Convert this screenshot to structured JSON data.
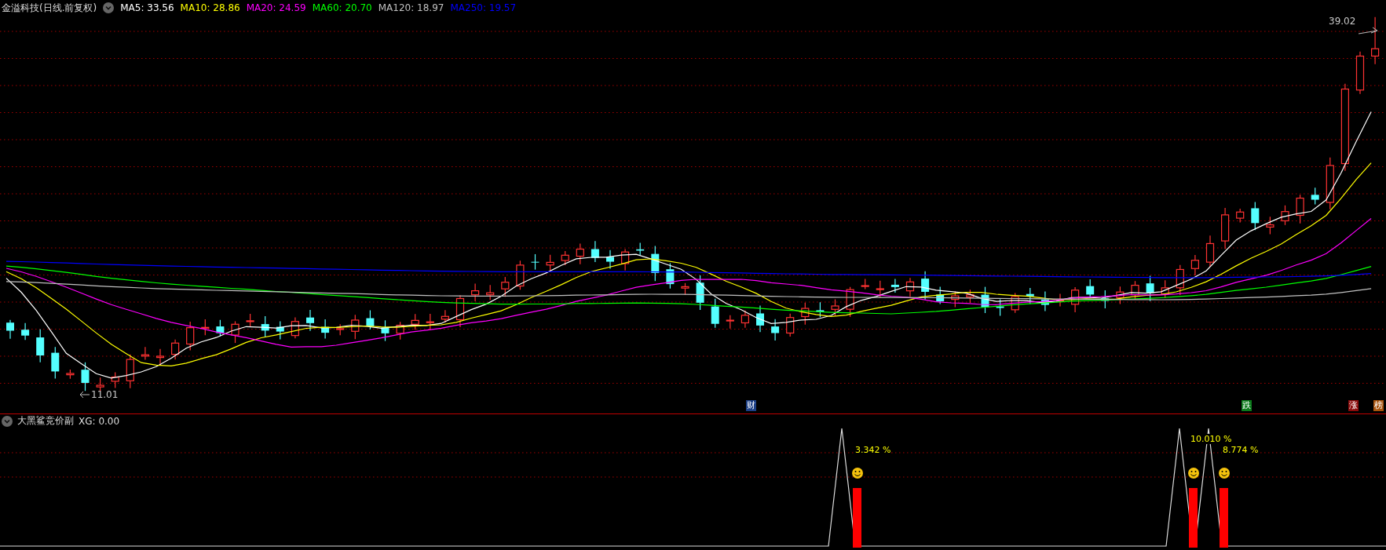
{
  "header": {
    "title": "金溢科技(日线.前复权)",
    "indicators": [
      {
        "label": "MA5: 33.56",
        "color": "#ffffff"
      },
      {
        "label": "MA10: 28.86",
        "color": "#ffff00"
      },
      {
        "label": "MA20: 24.59",
        "color": "#ff00ff"
      },
      {
        "label": "MA60: 20.70",
        "color": "#00ff00"
      },
      {
        "label": "MA120: 18.97",
        "color": "#c0c0c0"
      },
      {
        "label": "MA250: 19.57",
        "color": "#0000ff"
      }
    ]
  },
  "main_chart": {
    "high_label": "39.02",
    "low_label": "11.01",
    "markers": [
      {
        "text": "财",
        "color": "#1c3f86"
      },
      {
        "text": "跌",
        "color": "#0a7a1a"
      },
      {
        "text": "涨",
        "color": "#8a0b0b"
      },
      {
        "text": "榜",
        "color": "#a8530c"
      }
    ]
  },
  "sub_panel": {
    "title": "大黑鲨竞价副",
    "value": "XG: 0.00",
    "signals": [
      {
        "label": "3.342 %"
      },
      {
        "label": "10.010 %"
      },
      {
        "label": "8.774 %"
      }
    ]
  }
}
